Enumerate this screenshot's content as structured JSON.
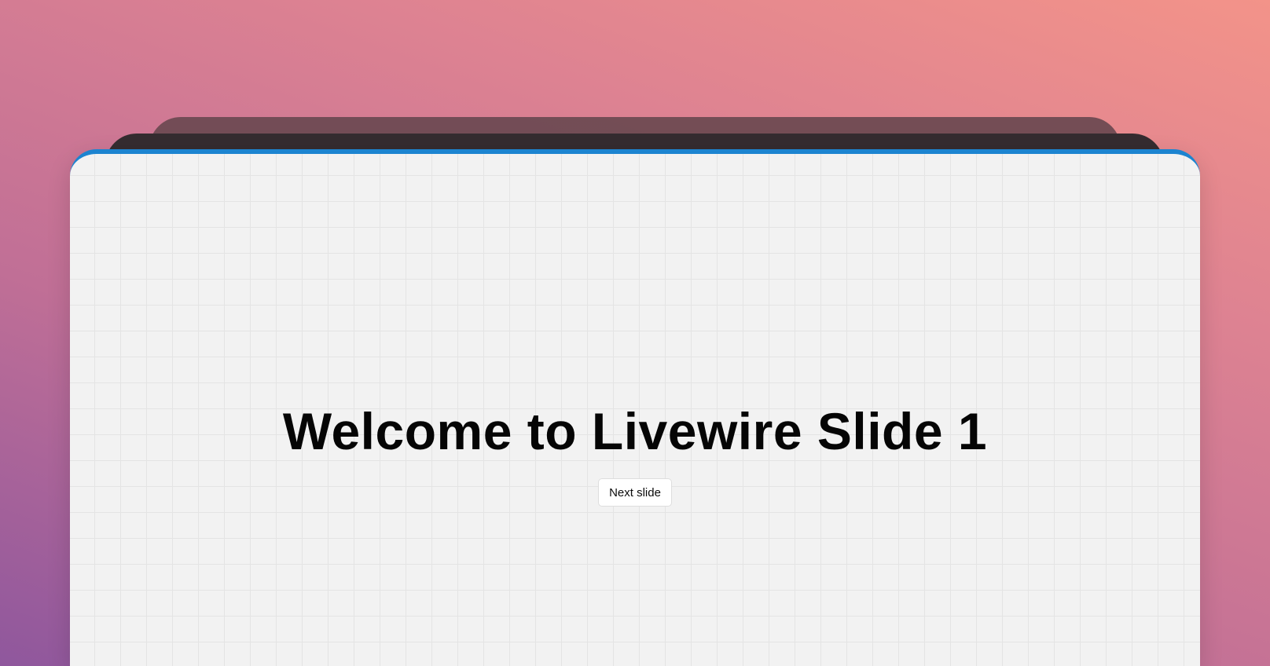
{
  "slide": {
    "title": "Welcome to Livewire Slide 1",
    "next_button_label": "Next slide"
  },
  "colors": {
    "accent": "#1c84d0",
    "slide_background": "#f2f2f2",
    "gradient_top_right": "#f39389",
    "gradient_bottom_left": "#8f579d"
  }
}
